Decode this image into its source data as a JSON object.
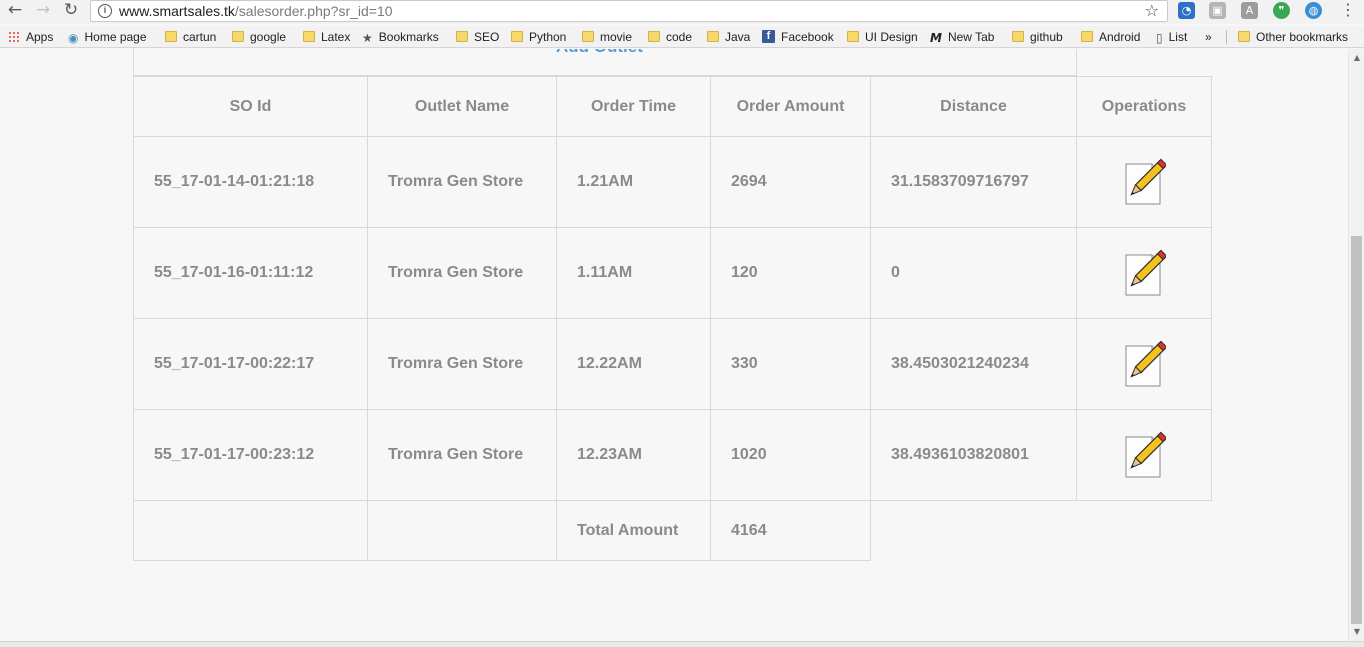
{
  "browser": {
    "url_host": "www.smartsales.tk",
    "url_path": "/salesorder.php?sr_id=10",
    "bookmarks": [
      {
        "label": "Apps",
        "icon": "apps-grid-icon"
      },
      {
        "label": "Home page",
        "icon": "globe-icon"
      },
      {
        "label": "cartun",
        "icon": "folder-icon"
      },
      {
        "label": "google",
        "icon": "folder-icon"
      },
      {
        "label": "Latex",
        "icon": "folder-icon"
      },
      {
        "label": "Bookmarks",
        "icon": "star-icon"
      },
      {
        "label": "SEO",
        "icon": "folder-icon"
      },
      {
        "label": "Python",
        "icon": "folder-icon"
      },
      {
        "label": "movie",
        "icon": "folder-icon"
      },
      {
        "label": "code",
        "icon": "folder-icon"
      },
      {
        "label": "Java",
        "icon": "folder-icon"
      },
      {
        "label": "Facebook",
        "icon": "facebook-icon"
      },
      {
        "label": "UI Design",
        "icon": "folder-icon"
      },
      {
        "label": "New Tab",
        "icon": "m-logo-icon"
      },
      {
        "label": "github",
        "icon": "folder-icon"
      },
      {
        "label": "Android",
        "icon": "folder-icon"
      },
      {
        "label": "List",
        "icon": "page-icon"
      }
    ],
    "overflow_label": "»",
    "other_bookmarks_label": "Other bookmarks"
  },
  "page": {
    "add_outlet_label": "Add Outlet",
    "table": {
      "headers": [
        "SO Id",
        "Outlet Name",
        "Order Time",
        "Order Amount",
        "Distance",
        "Operations"
      ],
      "rows": [
        {
          "so_id": "55_17-01-14-01:21:18",
          "outlet": "Tromra Gen Store",
          "time": "1.21AM",
          "amount": "2694",
          "distance": "31.1583709716797"
        },
        {
          "so_id": "55_17-01-16-01:11:12",
          "outlet": "Tromra Gen Store",
          "time": "1.11AM",
          "amount": "120",
          "distance": "0"
        },
        {
          "so_id": "55_17-01-17-00:22:17",
          "outlet": "Tromra Gen Store",
          "time": "12.22AM",
          "amount": "330",
          "distance": "38.4503021240234"
        },
        {
          "so_id": "55_17-01-17-00:23:12",
          "outlet": "Tromra Gen Store",
          "time": "12.23AM",
          "amount": "1020",
          "distance": "38.4936103820801"
        }
      ],
      "total_label": "Total Amount",
      "total_value": "4164"
    }
  },
  "colors": {
    "text": "#8a8a8a",
    "border": "#d9d9d9",
    "link": "#5b9bd5",
    "background": "#f7f7f7"
  }
}
